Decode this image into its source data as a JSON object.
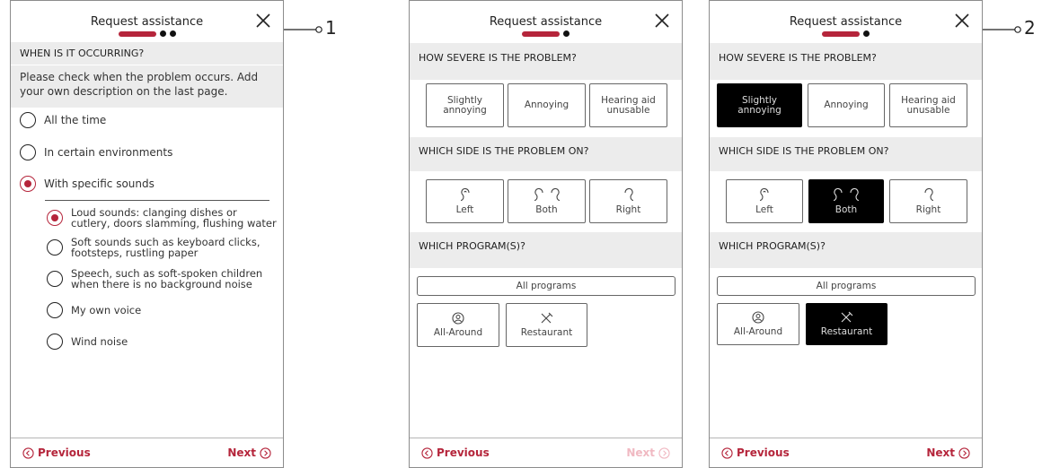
{
  "screen1": {
    "title": "Request assistance",
    "question": "WHEN IS IT OCCURRING?",
    "instruction": "Please check when the problem occurs. Add your own description on the last page.",
    "options": [
      {
        "label": "All the time",
        "selected": false
      },
      {
        "label": "In certain environments",
        "selected": false
      },
      {
        "label": "With specific sounds",
        "selected": true
      }
    ],
    "sub_options": [
      {
        "line1": "Loud sounds: clanging dishes or",
        "line2": "cutlery, doors slamming, flushing water",
        "selected": true
      },
      {
        "line1": "Soft sounds such as keyboard clicks,",
        "line2": "footsteps, rustling paper",
        "selected": false
      },
      {
        "line1": "Speech, such as soft-spoken children",
        "line2": "when there is no background noise",
        "selected": false
      },
      {
        "line1": "My own voice",
        "line2": "",
        "selected": false
      },
      {
        "line1": "Wind noise",
        "line2": "",
        "selected": false
      }
    ],
    "prev": "Previous",
    "next": "Next"
  },
  "screen2": {
    "title": "Request assistance",
    "q_severity": "HOW SEVERE IS THE PROBLEM?",
    "severity": [
      {
        "line1": "Slightly",
        "line2": "annoying"
      },
      {
        "line1": "Annoying",
        "line2": ""
      },
      {
        "line1": "Hearing aid",
        "line2": "unusable"
      }
    ],
    "q_side": "WHICH SIDE IS THE PROBLEM ON?",
    "sides": [
      "Left",
      "Both",
      "Right"
    ],
    "q_program": "WHICH PROGRAM(S)?",
    "all_programs": "All programs",
    "programs": [
      "All-Around",
      "Restaurant"
    ],
    "prev": "Previous",
    "next": "Next"
  },
  "screen3": {
    "title": "Request assistance",
    "q_severity": "HOW SEVERE IS THE PROBLEM?",
    "severity": [
      {
        "line1": "Slightly",
        "line2": "annoying"
      },
      {
        "line1": "Annoying",
        "line2": ""
      },
      {
        "line1": "Hearing aid",
        "line2": "unusable"
      }
    ],
    "selected_severity": "Slightly annoying",
    "q_side": "WHICH SIDE IS THE PROBLEM ON?",
    "sides": [
      "Left",
      "Both",
      "Right"
    ],
    "selected_side": "Both",
    "q_program": "WHICH PROGRAM(S)?",
    "all_programs": "All programs",
    "programs": [
      "All-Around",
      "Restaurant"
    ],
    "selected_program": "Restaurant",
    "prev": "Previous",
    "next": "Next"
  },
  "callouts": [
    "1",
    "2"
  ],
  "colors": {
    "accent": "#b5253b",
    "accent_disabled": "#f0b9c2",
    "section_bg": "#ececec",
    "selected_bg": "#000000"
  },
  "icons": [
    "close-icon",
    "ear-left-icon",
    "ear-both-icon",
    "ear-right-icon",
    "all-around-icon",
    "restaurant-icon",
    "chevron-left-circle-icon",
    "chevron-right-circle-icon"
  ]
}
